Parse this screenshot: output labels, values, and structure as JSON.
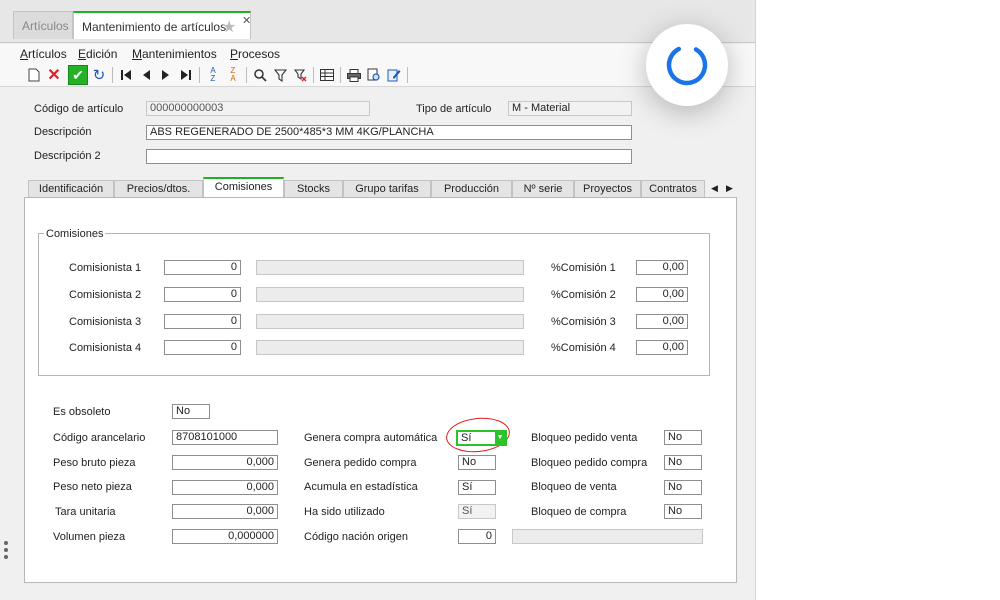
{
  "tabs": [
    {
      "label": "Artículos",
      "active": false
    },
    {
      "label": "Mantenimiento de artículos",
      "active": true
    }
  ],
  "menu": [
    {
      "label": "Artículos",
      "underline_idx": 0
    },
    {
      "label": "Edición",
      "underline_idx": 0
    },
    {
      "label": "Mantenimientos",
      "underline_idx": 0
    },
    {
      "label": "Procesos",
      "underline_idx": 0
    }
  ],
  "header": {
    "codigo_label": "Código de artículo",
    "codigo_value": "000000000003",
    "tipo_label": "Tipo de artículo",
    "tipo_value": "M  - Material",
    "descripcion_label": "Descripción",
    "descripcion_value": "ABS REGENERADO DE 2500*485*3 MM 4KG/PLANCHA",
    "descripcion2_label": "Descripción 2",
    "descripcion2_value": ""
  },
  "subtabs": [
    "Identificación",
    "Precios/dtos.",
    "Comisiones",
    "Stocks",
    "Grupo tarifas",
    "Producción",
    "Nº serie",
    "Proyectos",
    "Contratos"
  ],
  "active_subtab": "Comisiones",
  "comisiones": {
    "title": "Comisiones",
    "rows": [
      {
        "label": "Comisionista 1",
        "value": "0",
        "pct_label": "%Comisión 1",
        "pct_value": "0,00"
      },
      {
        "label": "Comisionista 2",
        "value": "0",
        "pct_label": "%Comisión 2",
        "pct_value": "0,00"
      },
      {
        "label": "Comisionista 3",
        "value": "0",
        "pct_label": "%Comisión 3",
        "pct_value": "0,00"
      },
      {
        "label": "Comisionista 4",
        "value": "0",
        "pct_label": "%Comisión 4",
        "pct_value": "0,00"
      }
    ]
  },
  "props": {
    "es_obsoleto": {
      "label": "Es obsoleto",
      "value": "No"
    },
    "codigo_arancelario": {
      "label": "Código arancelario",
      "value": "8708101000"
    },
    "peso_bruto": {
      "label": "Peso bruto pieza",
      "value": "0,000"
    },
    "peso_neto": {
      "label": "Peso neto pieza",
      "value": "0,000"
    },
    "tara": {
      "label": "Tara unitaria",
      "value": "0,000"
    },
    "volumen": {
      "label": "Volumen pieza",
      "value": "0,000000"
    },
    "genera_compra": {
      "label": "Genera compra automática",
      "value": "Sí"
    },
    "genera_pedido": {
      "label": "Genera pedido compra",
      "value": "No"
    },
    "acumula": {
      "label": "Acumula en estadística",
      "value": "Sí"
    },
    "utilizado": {
      "label": "Ha sido utilizado",
      "value": "Sí"
    },
    "nacion": {
      "label": "Código nación origen",
      "value": "0",
      "desc": ""
    },
    "bloq_ped_venta": {
      "label": "Bloqueo pedido venta",
      "value": "No"
    },
    "bloq_ped_compra": {
      "label": "Bloqueo pedido compra",
      "value": "No"
    },
    "bloq_venta": {
      "label": "Bloqueo de venta",
      "value": "No"
    },
    "bloq_compra": {
      "label": "Bloqueo de compra",
      "value": "No"
    }
  },
  "colors": {
    "accent_green": "#20b020",
    "highlight_red": "#e01818",
    "spinner_blue": "#1a73e8"
  }
}
